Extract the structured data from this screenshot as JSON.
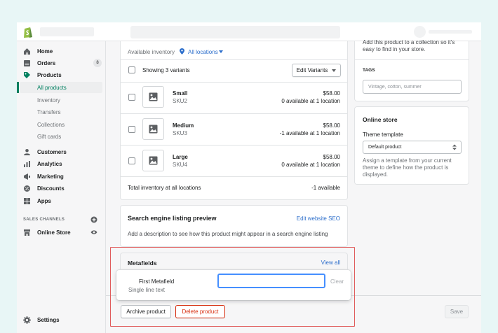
{
  "sidebar": {
    "items": [
      {
        "label": "Home"
      },
      {
        "label": "Orders",
        "badge": "8"
      },
      {
        "label": "Products"
      },
      {
        "label": "All products"
      },
      {
        "label": "Inventory"
      },
      {
        "label": "Transfers"
      },
      {
        "label": "Collections"
      },
      {
        "label": "Gift cards"
      },
      {
        "label": "Customers"
      },
      {
        "label": "Analytics"
      },
      {
        "label": "Marketing"
      },
      {
        "label": "Discounts"
      },
      {
        "label": "Apps"
      }
    ],
    "sales_channels_label": "SALES CHANNELS",
    "online_store": "Online Store",
    "settings": "Settings"
  },
  "inventory": {
    "available_label": "Available inventory",
    "location_link": "All locations",
    "showing_variants": "Showing 3 variants",
    "edit_variants": "Edit Variants",
    "variants": [
      {
        "name": "Small",
        "sku": "SKU2",
        "price": "$58.00",
        "availability": "0 available at 1 location"
      },
      {
        "name": "Medium",
        "sku": "SKU3",
        "price": "$58.00",
        "availability": "-1 available at 1 location"
      },
      {
        "name": "Large",
        "sku": "SKU4",
        "price": "$58.00",
        "availability": "0 available at 1 location"
      }
    ],
    "total_label": "Total inventory at all locations",
    "total_value": "-1 available"
  },
  "seo": {
    "title": "Search engine listing preview",
    "edit_link": "Edit website SEO",
    "description": "Add a description to see how this product might appear in a search engine listing"
  },
  "metafields": {
    "title": "Metafields",
    "view_all": "View all",
    "field_name": "First Metafield",
    "field_type": "Single line text",
    "field_value": "",
    "clear": "Clear"
  },
  "actions": {
    "archive": "Archive product",
    "delete": "Delete product",
    "save": "Save"
  },
  "right": {
    "collection_hint_1": "Add this product to a collection so it's",
    "collection_hint_2": "easy to find in your store.",
    "tags_label": "TAGS",
    "tags_placeholder": "Vintage, cotton, summer",
    "online_store_title": "Online store",
    "theme_template_label": "Theme template",
    "theme_template_value": "Default product",
    "theme_help_1": "Assign a template from your current",
    "theme_help_2": "theme to define how the product is",
    "theme_help_3": "displayed."
  },
  "colors": {
    "accent": "#008060",
    "link": "#2c6ecb",
    "highlight": "#e05b5b",
    "critical": "#d72c0d"
  }
}
